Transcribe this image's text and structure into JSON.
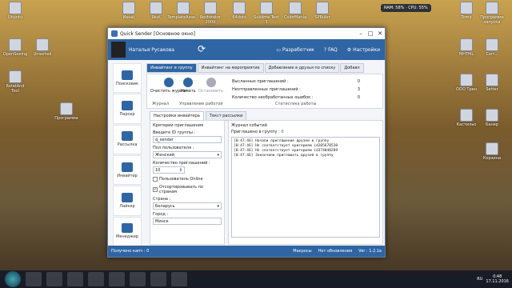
{
  "desktop": {
    "icons": [
      "Ubuntu",
      "Иена\\",
      "Яка\\",
      "Sbi - Ярлык",
      "TemplateAsse...",
      "Restorator 2009",
      "64dots",
      "Sublime Text 3",
      "ColorMania",
      "SPRuler",
      "Tomo",
      "Программа запуска",
      "OpenSeeing",
      "Unsorted",
      "RotatAnd Tool",
      "Программа",
      "MHTML",
      "Corr...",
      "ООО Трен",
      "Setter",
      "Кастильо",
      "Банер",
      "Корзина"
    ],
    "ram": "RAM: 58%",
    "cpu": "CPU: 55%"
  },
  "window": {
    "title": "Quick Sender [Основное окно]",
    "user": "Наталья Русакова",
    "header_buttons": [
      "Разработчик",
      "FAQ",
      "Настройки"
    ],
    "sidebar": [
      "Поисковик",
      "Парсер",
      "Рассылка",
      "Инвайтер",
      "Лайкер",
      "Менеджер"
    ],
    "tabs": [
      "Инвайтинг в группу",
      "Инвайтинг на мероприятие",
      "Добавление в друзья по списку",
      "Добавл"
    ],
    "ribbon": {
      "clear": "Очистить журнал",
      "start": "Начать",
      "stop": "Остановить",
      "group_journal": "Журнал",
      "group_control": "Управление работой",
      "group_stats": "Статистика работы",
      "stats": [
        {
          "label": "Высланных приглашений :",
          "value": "0"
        },
        {
          "label": "Неотправленных приглашений :",
          "value": "3"
        },
        {
          "label": "Количество необработанных ошибок :",
          "value": "0"
        }
      ]
    },
    "subtabs": [
      "Настройки инвайтера",
      "Текст рассылки"
    ],
    "criteria": {
      "title": "Критерии приглашения",
      "group_id_label": "Введите ID группы :",
      "group_id": "q_sender",
      "gender_label": "Пол пользователя :",
      "gender": "Женский",
      "count_label": "Количество приглашений :",
      "count": "10",
      "online": "Пользователь Online",
      "filter_countries": "Отсортировывать по странам",
      "country_label": "Страна :",
      "country": "Беларусь",
      "city_label": "Город :",
      "city": "Минск"
    },
    "journal": {
      "title": "Журнал событий",
      "invited_label": "Приглашено в группу :",
      "invited": "0",
      "lines": [
        "[0:47:46] Начали приглашение друзей в группу",
        "[0:47:46] Не соответствует критериям id205670530",
        "[0:47:46] Не соответствует критериям id374040289",
        "[0:47:46] Закончили приглашать друзей в группу"
      ]
    },
    "status": {
      "got_label": "Получено капч :",
      "got": "0",
      "macros": "Макросы",
      "updates": "Нет обновления",
      "version": "Ver : 1.2.1a"
    }
  },
  "taskbar": {
    "lang": "RU",
    "time": "0:48",
    "date": "17.11.2016"
  }
}
